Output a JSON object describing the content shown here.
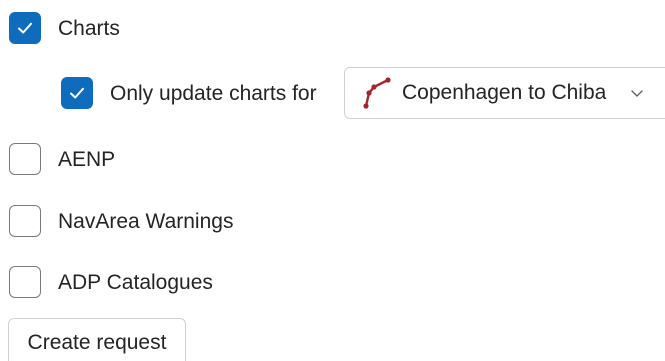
{
  "options": {
    "charts": {
      "label": "Charts",
      "checked": true
    },
    "only_update": {
      "label": "Only update charts for",
      "checked": true
    },
    "aenp": {
      "label": "AENP",
      "checked": false
    },
    "navarea": {
      "label": "NavArea Warnings",
      "checked": false
    },
    "adp": {
      "label": "ADP Catalogues",
      "checked": false
    }
  },
  "route_select": {
    "value": "Copenhagen to Chiba",
    "icon": "route-icon",
    "icon_color": "#a4262c"
  },
  "create_request": {
    "label": "Create request"
  },
  "colors": {
    "accent": "#0f6cbd",
    "border": "#d1d1d1",
    "text": "#242424"
  }
}
